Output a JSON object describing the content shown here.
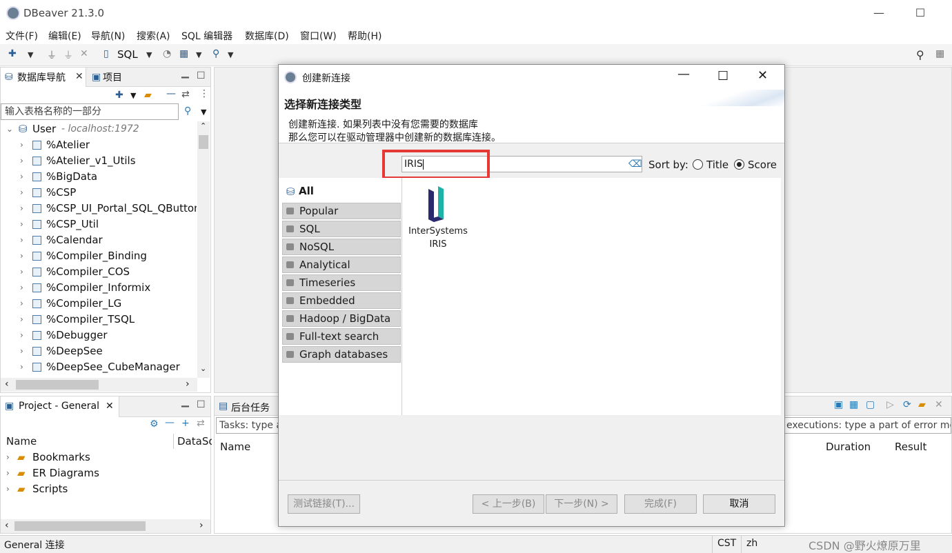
{
  "window": {
    "title": "DBeaver 21.3.0",
    "minimize": "—",
    "maximize": "☐"
  },
  "menu": [
    "文件(F)",
    "编辑(E)",
    "导航(N)",
    "搜索(A)",
    "SQL 编辑器",
    "数据库(D)",
    "窗口(W)",
    "帮助(H)"
  ],
  "toolbar": {
    "sql_label": "SQL"
  },
  "navigator": {
    "tab_label": "数据库导航",
    "tab2_label": "项目",
    "filter_placeholder": "输入表格名称的一部分",
    "root": {
      "label": "User",
      "host": "- localhost:1972"
    },
    "items": [
      "%Atelier",
      "%Atelier_v1_Utils",
      "%BigData",
      "%CSP",
      "%CSP_UI_Portal_SQL_QButton",
      "%CSP_Util",
      "%Calendar",
      "%Compiler_Binding",
      "%Compiler_COS",
      "%Compiler_Informix",
      "%Compiler_LG",
      "%Compiler_TSQL",
      "%Debugger",
      "%DeepSee",
      "%DeepSee_CubeManager"
    ]
  },
  "project": {
    "tab_label": "Project - General",
    "col_name": "Name",
    "col_datasource": "DataSo",
    "items": [
      "Bookmarks",
      "ER Diagrams",
      "Scripts"
    ]
  },
  "tasks": {
    "tab_label": "后台任务",
    "filter_placeholder": "Tasks: type a",
    "error_placeholder": "executions: type a part of error me",
    "col_name": "Name",
    "col_duration": "Duration",
    "col_result": "Result"
  },
  "dialog": {
    "title": "创建新连接",
    "heading": "选择新连接类型",
    "desc_line1": "创建新连接. 如果列表中没有您需要的数据库",
    "desc_line2": "那么您可以在驱动管理器中创建新的数据库连接。",
    "search_value": "IRIS",
    "sort_by": "Sort by:",
    "sort_title": "Title",
    "sort_score": "Score",
    "categories": [
      "All",
      "Popular",
      "SQL",
      "NoSQL",
      "Analytical",
      "Timeseries",
      "Embedded",
      "Hadoop / BigData",
      "Full-text search",
      "Graph databases"
    ],
    "driver": {
      "line1": "InterSystems",
      "line2": "IRIS"
    },
    "buttons": {
      "test": "测试链接(T)...",
      "back": "< 上一步(B)",
      "next": "下一步(N) >",
      "finish": "完成(F)",
      "cancel": "取消"
    }
  },
  "status": {
    "left": "General 连接",
    "tz": "CST",
    "lang": "zh",
    "watermark": "CSDN @野火燎原万里"
  },
  "colors": {
    "highlight": "#e53935",
    "accent": "#2a5e94"
  }
}
